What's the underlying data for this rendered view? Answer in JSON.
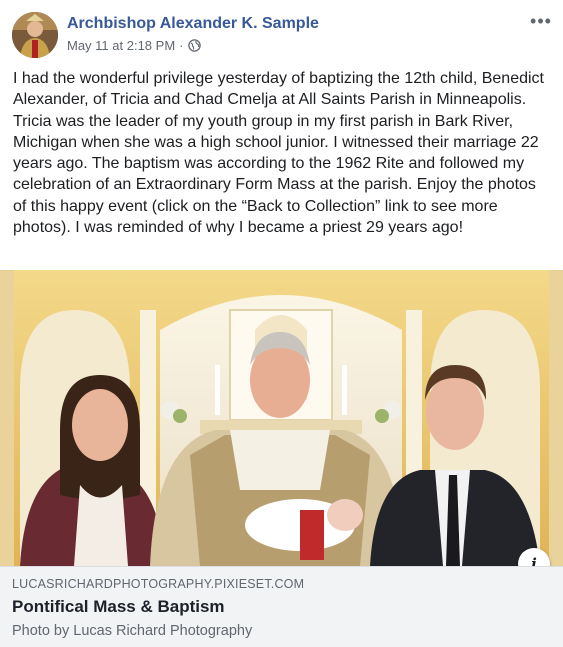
{
  "post": {
    "author": "Archbishop Alexander K. Sample",
    "timestamp": "May 11 at 2:18 PM",
    "separator": "·",
    "privacy_icon": "globe-icon",
    "more_icon": "more-options-icon",
    "more_label": "•••",
    "text": "I had the wonderful privilege yesterday of baptizing the 12th child, Benedict Alexander, of Tricia and Chad Cmelja at All Saints Parish in Minneapolis. Tricia was the leader of my youth group in my first parish in Bark River, Michigan when she was a high school junior. I witnessed their marriage 22 years ago. The baptism was according to the 1962 Rite and followed my celebration of an Extraordinary Form Mass at the parish. Enjoy the photos of this happy event (click on the “Back to Collection” link to see more photos). I was reminded of why I became a priest 29 years ago!"
  },
  "link_preview": {
    "domain": "LUCASRICHARDPHOTOGRAPHY.PIXIESET.COM",
    "title": "Pontifical Mass & Baptism",
    "description": "Photo by Lucas Richard Photography",
    "info_label": "i"
  },
  "colors": {
    "author_link": "#385898",
    "meta_gray": "#606770",
    "link_box_bg": "#f2f3f5"
  }
}
